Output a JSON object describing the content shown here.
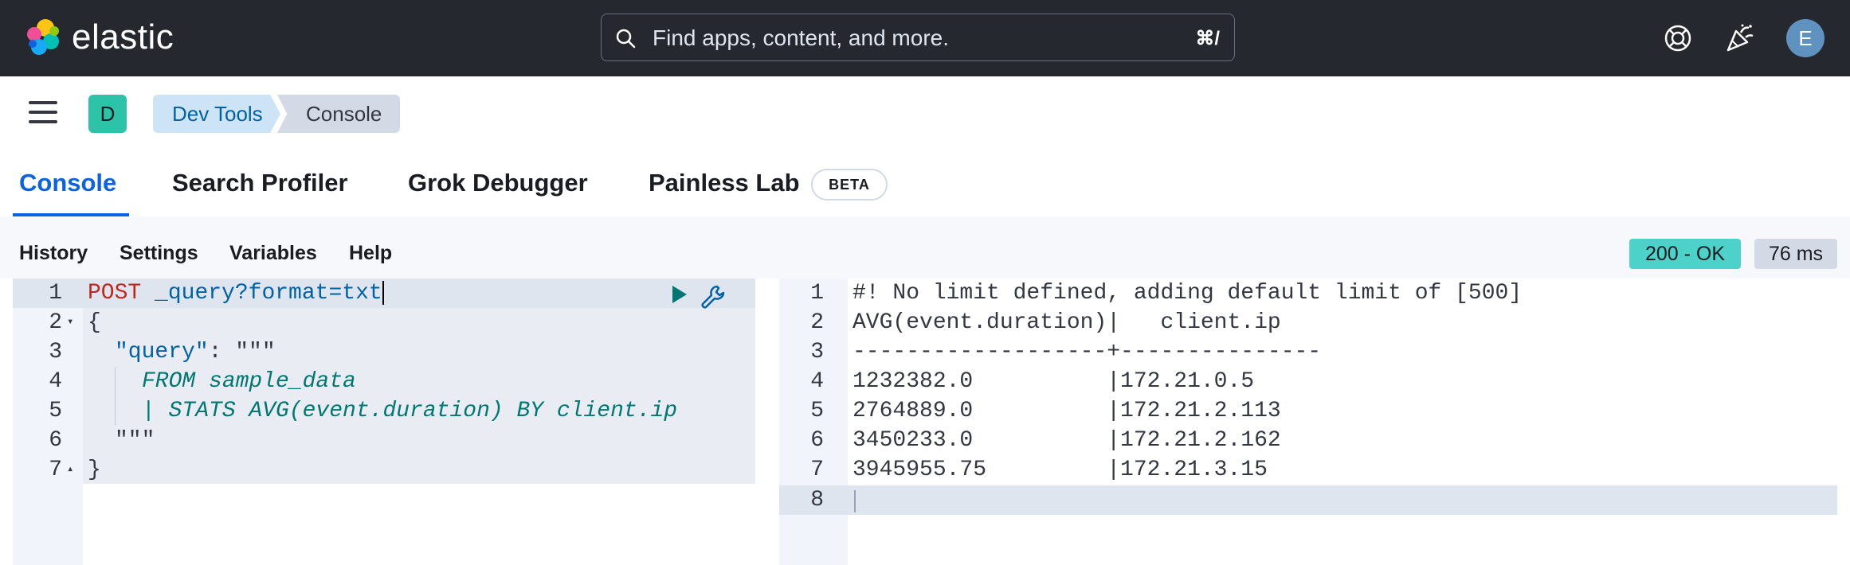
{
  "header": {
    "brand": "elastic",
    "search_placeholder": "Find apps, content, and more.",
    "search_shortcut": "⌘/",
    "avatar_initial": "E"
  },
  "subbar": {
    "space_initial": "D",
    "breadcrumbs": [
      "Dev Tools",
      "Console"
    ]
  },
  "tabs": [
    {
      "label": "Console",
      "active": true
    },
    {
      "label": "Search Profiler",
      "active": false
    },
    {
      "label": "Grok Debugger",
      "active": false
    },
    {
      "label": "Painless Lab",
      "active": false
    }
  ],
  "beta_badge": "BETA",
  "toolbar": {
    "items": [
      "History",
      "Settings",
      "Variables",
      "Help"
    ],
    "status": "200 - OK",
    "duration": "76 ms"
  },
  "request": {
    "line_numbers": [
      "1",
      "2",
      "3",
      "4",
      "5",
      "6",
      "7"
    ],
    "method": "POST",
    "path": "_query?format=txt",
    "brace_open": "{",
    "query_key": "\"query\"",
    "colon": ": ",
    "triple_quote": "\"\"\"",
    "esql_line1": "FROM sample_data",
    "esql_line2": "| STATS AVG(event.duration) BY client.ip",
    "brace_close": "}"
  },
  "response": {
    "line_numbers": [
      "1",
      "2",
      "3",
      "4",
      "5",
      "6",
      "7",
      "8"
    ],
    "lines": [
      "#! No limit defined, adding default limit of [500]",
      "AVG(event.duration)|   client.ip   ",
      "-------------------+---------------",
      "1232382.0          |172.21.0.5     ",
      "2764889.0          |172.21.2.113   ",
      "3450233.0          |172.21.2.162   ",
      "3945955.75         |172.21.3.15    ",
      ""
    ]
  },
  "colors": {
    "header_bg": "#25282f",
    "accent": "#0b64dd",
    "status_ok": "#4dd2ca",
    "method": "#bd271e",
    "esql": "#007871"
  }
}
